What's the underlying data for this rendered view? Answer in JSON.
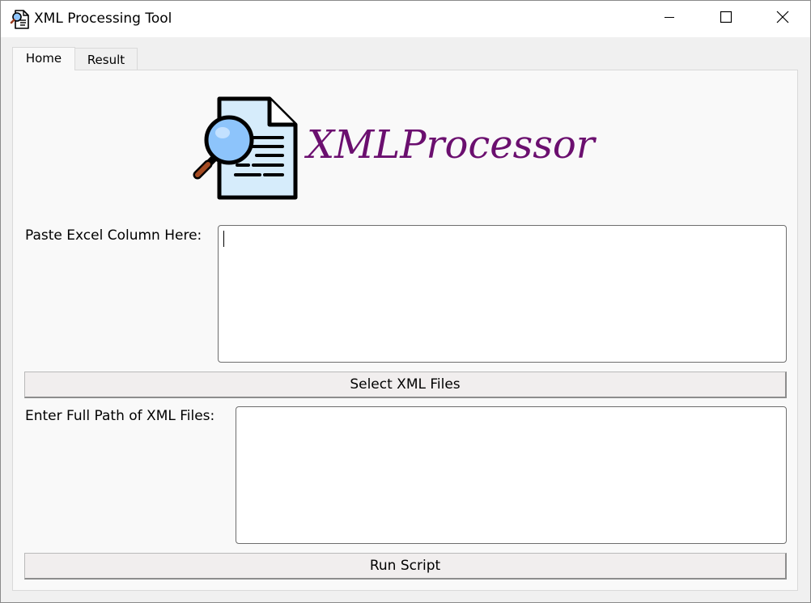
{
  "window": {
    "title": "XML Processing Tool",
    "controls": [
      "minimize-icon",
      "maximize-icon",
      "close-icon"
    ]
  },
  "tabs": [
    {
      "label": "Home",
      "selected": true
    },
    {
      "label": "Result",
      "selected": false
    }
  ],
  "logo": {
    "text": "XMLProcessor",
    "icon": "document-search-icon",
    "text_color": "#6b0f6f"
  },
  "form": {
    "excel_label": "Paste Excel Column Here:",
    "excel_value": "",
    "select_button": "Select XML Files",
    "path_label": "Enter Full Path of XML Files:",
    "path_value": "",
    "run_button": "Run Script"
  }
}
